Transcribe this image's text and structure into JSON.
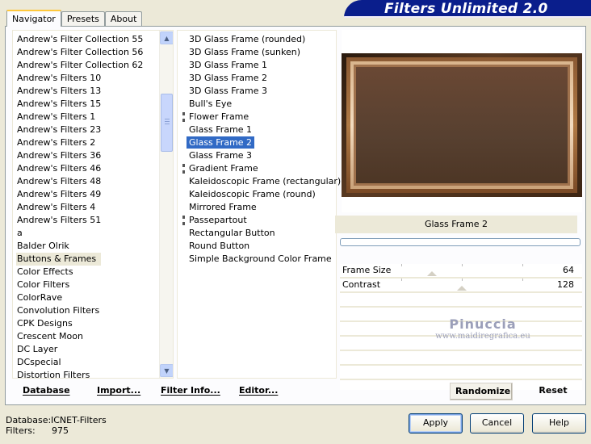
{
  "header": {
    "title": "Filters Unlimited 2.0"
  },
  "tabs": [
    {
      "label": "Navigator",
      "active": true
    },
    {
      "label": "Presets",
      "active": false
    },
    {
      "label": "About",
      "active": false
    }
  ],
  "categories": [
    "Andrew's Filter Collection 55",
    "Andrew's Filter Collection 56",
    "Andrew's Filter Collection 62",
    "Andrew's Filters 10",
    "Andrew's Filters 13",
    "Andrew's Filters 15",
    "Andrew's Filters 1",
    "Andrew's Filters 23",
    "Andrew's Filters 2",
    "Andrew's Filters 36",
    "Andrew's Filters 46",
    "Andrew's Filters 48",
    "Andrew's Filters 49",
    "Andrew's Filters 4",
    "Andrew's Filters 51",
    "a",
    "Balder Olrik",
    "Buttons & Frames",
    "Color Effects",
    "Color Filters",
    "ColorRave",
    "Convolution Filters",
    "CPK Designs",
    "Crescent Moon",
    "DC Layer",
    "DCspecial",
    "Distortion Filters"
  ],
  "selected_category": "Buttons & Frames",
  "filters": [
    {
      "label": "3D Glass Frame (rounded)",
      "marked": false
    },
    {
      "label": "3D Glass Frame (sunken)",
      "marked": false
    },
    {
      "label": "3D Glass Frame 1",
      "marked": false
    },
    {
      "label": "3D Glass Frame 2",
      "marked": false
    },
    {
      "label": "3D Glass Frame 3",
      "marked": false
    },
    {
      "label": "Bull's Eye",
      "marked": false
    },
    {
      "label": "Flower Frame",
      "marked": true
    },
    {
      "label": "Glass Frame 1",
      "marked": false
    },
    {
      "label": "Glass Frame 2",
      "marked": false
    },
    {
      "label": "Glass Frame 3",
      "marked": false
    },
    {
      "label": "Gradient Frame",
      "marked": true
    },
    {
      "label": "Kaleidoscopic Frame (rectangular)",
      "marked": false
    },
    {
      "label": "Kaleidoscopic Frame (round)",
      "marked": false
    },
    {
      "label": "Mirrored Frame",
      "marked": false
    },
    {
      "label": "Passepartout",
      "marked": true
    },
    {
      "label": "Rectangular Button",
      "marked": false
    },
    {
      "label": "Round Button",
      "marked": false
    },
    {
      "label": "Simple Background Color Frame",
      "marked": false
    }
  ],
  "selected_filter": "Glass Frame 2",
  "preview": {
    "filter_name": "Glass Frame 2",
    "progress": 0
  },
  "params": [
    {
      "label": "Frame Size",
      "value": "64",
      "slider_value": 64,
      "slider_max": 255
    },
    {
      "label": "Contrast",
      "value": "128",
      "slider_value": 128,
      "slider_max": 255
    }
  ],
  "watermark": {
    "line1": "Pinuccia",
    "line2": "www.maidiregrafica.eu"
  },
  "panel_buttons": {
    "database": "Database",
    "import": "Import...",
    "filter_info": "Filter Info...",
    "editor": "Editor...",
    "randomize": "Randomize",
    "reset": "Reset"
  },
  "info": {
    "database_label": "Database:",
    "database_value": "ICNET-Filters",
    "filters_label": "Filters:",
    "filters_value": "975"
  },
  "dialog_buttons": {
    "apply": "Apply",
    "cancel": "Cancel",
    "help": "Help"
  },
  "colors": {
    "banner": "#0a1e8c",
    "selection": "#316ac5",
    "face": "#ece9d8"
  }
}
